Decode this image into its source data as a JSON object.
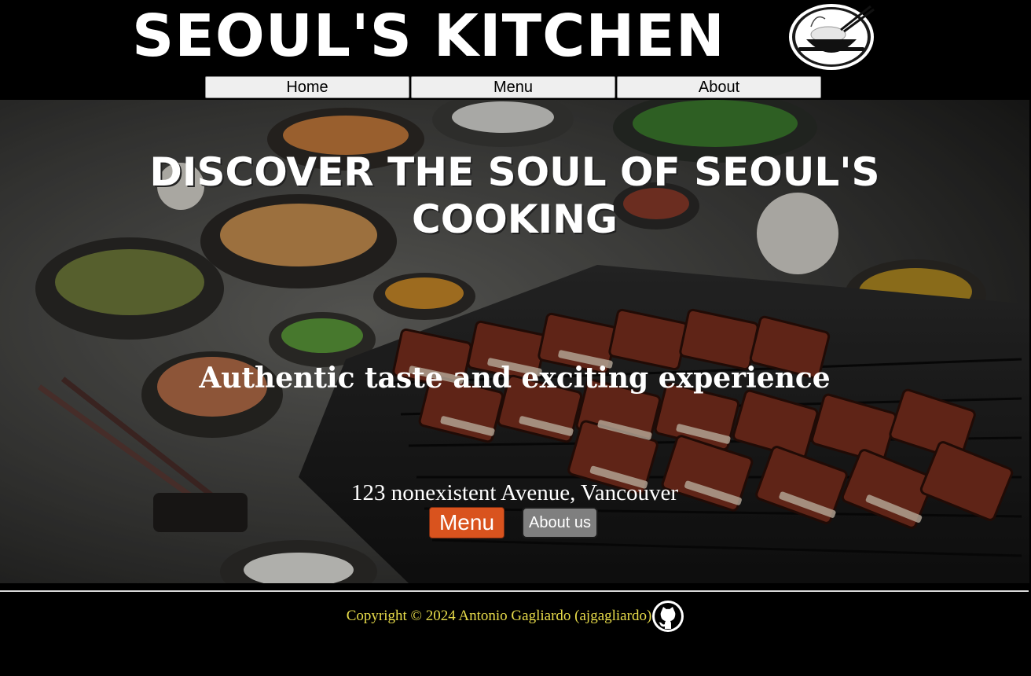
{
  "header": {
    "logo_text": "SEOUL'S KITCHEN",
    "logo_icon": "rice-bowl-chopsticks-icon"
  },
  "nav": {
    "items": [
      {
        "label": "Home"
      },
      {
        "label": "Menu"
      },
      {
        "label": "About"
      }
    ]
  },
  "hero": {
    "title": "DISCOVER THE SOUL OF SEOUL'S COOKING",
    "subtitle": "Authentic taste and exciting experience",
    "address": "123 nonexistent Avenue, Vancouver",
    "menu_button": "Menu",
    "about_button": "About us",
    "image_subject": "grilled-pork-belly-and-banchan"
  },
  "footer": {
    "copyright": "Copyright © 2024 Antonio Gagliardo (ajgagliardo)",
    "icon": "github-icon"
  },
  "colors": {
    "background": "#000000",
    "nav_button": "#efefef",
    "menu_button": "#d9531e",
    "about_button": "#7f7f7f",
    "copyright_text": "#e8dc4a"
  }
}
